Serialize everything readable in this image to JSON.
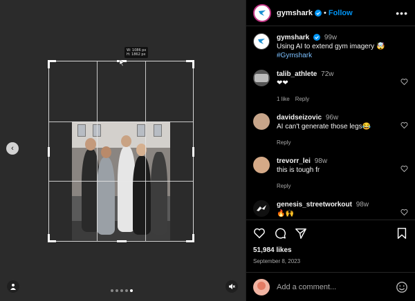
{
  "post": {
    "author": "gymshark",
    "separator": "•",
    "follow_label": "Follow",
    "more_label": "•••",
    "caption_time": "99w",
    "caption_text": "Using AI to extend gym imagery 🤯",
    "hashtag": "#Gymshark",
    "likes": "51,984 likes",
    "date": "September 8, 2023"
  },
  "editor": {
    "dimension_w": "W: 1086 px",
    "dimension_h": "H: 1862 px"
  },
  "carousel": {
    "prev_label": "‹",
    "count": 5,
    "active_index": 4
  },
  "comments": [
    {
      "user": "talib_athlete",
      "time": "72w",
      "text": "❤❤",
      "likes": "1 like",
      "reply": "Reply"
    },
    {
      "user": "davidseizovic",
      "time": "96w",
      "text": "AI can't generate those legs😂",
      "reply": "Reply"
    },
    {
      "user": "trevorr_lei",
      "time": "98w",
      "text": "this is tough fr",
      "reply": "Reply"
    },
    {
      "user": "genesis_streetworkout",
      "time": "98w",
      "text": "🔥🙌"
    }
  ],
  "composer": {
    "placeholder": "Add a comment..."
  },
  "colors": {
    "accent": "#0095f6",
    "media_bg": "#2b2b2b",
    "background": "#000000"
  }
}
